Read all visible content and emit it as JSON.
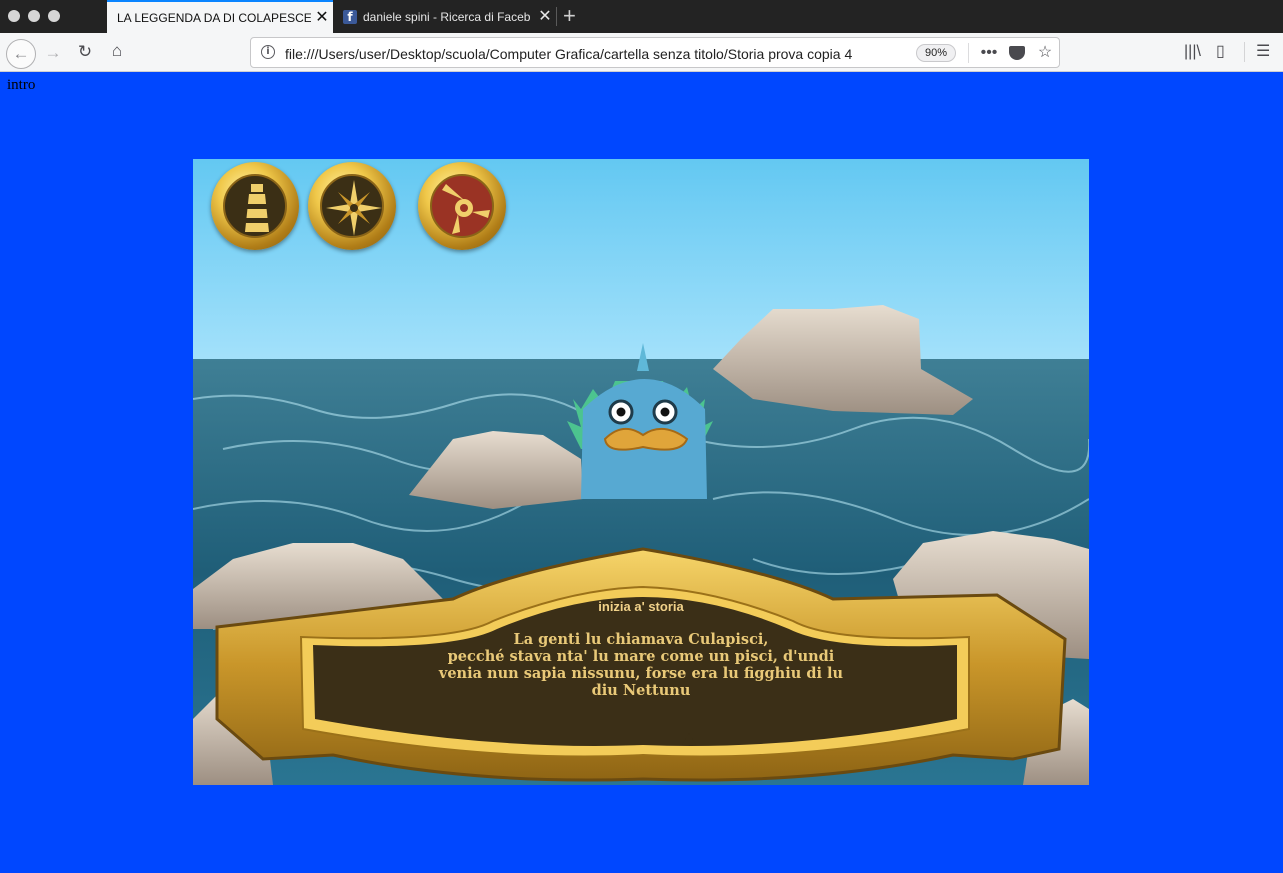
{
  "browser": {
    "tabs": [
      {
        "title": "LA LEGGENDA DA DI COLAPESCE",
        "active": true
      },
      {
        "title": "daniele spini - Ricerca di Faceb",
        "active": false,
        "icon": "facebook-icon"
      }
    ],
    "url": "file:///Users/user/Desktop/scuola/Computer Grafica/cartella senza titolo/Storia prova copia 4",
    "zoom": "90%"
  },
  "page": {
    "intro_label": "intro",
    "background_color": "#0047ff"
  },
  "game": {
    "medals": [
      {
        "name": "lighthouse-icon"
      },
      {
        "name": "compass-icon"
      },
      {
        "name": "trinacria-icon"
      }
    ],
    "banner": {
      "title": "inizia a' storia",
      "line1": "La genti lu chiamava Culapisci,",
      "line2": "pecché stava nta' lu mare come un pisci, d'undi",
      "line3": "venia nun sapia nissunu, forse era lu figghiu di lu",
      "line4": "diu Nettunu"
    }
  }
}
